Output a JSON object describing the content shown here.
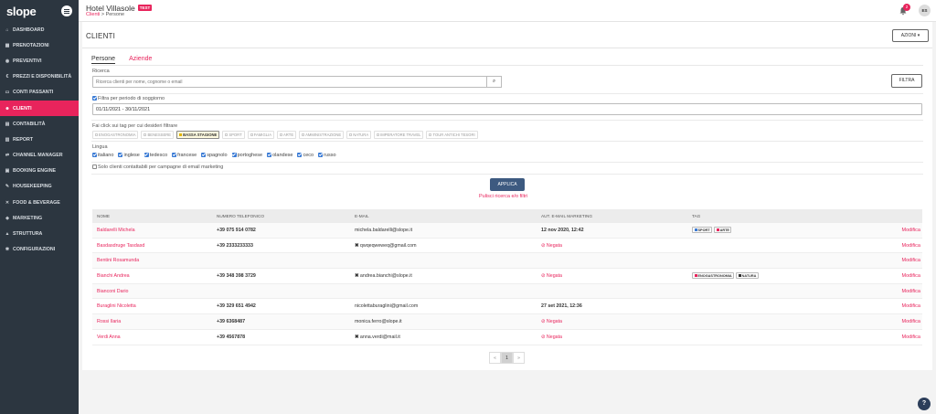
{
  "app": {
    "logo": "slope"
  },
  "sidebar": {
    "items": [
      {
        "icon": "⌂",
        "label": "DASHBOARD"
      },
      {
        "icon": "▦",
        "label": "PRENOTAZIONI"
      },
      {
        "icon": "◉",
        "label": "PREVENTIVI"
      },
      {
        "icon": "€",
        "label": "PREZZI E DISPONIBILITÀ"
      },
      {
        "icon": "▭",
        "label": "CONTI PASSANTI"
      },
      {
        "icon": "☻",
        "label": "CLIENTI",
        "active": true
      },
      {
        "icon": "▤",
        "label": "CONTABILITÀ"
      },
      {
        "icon": "▥",
        "label": "REPORT"
      },
      {
        "icon": "⇄",
        "label": "CHANNEL MANAGER"
      },
      {
        "icon": "▣",
        "label": "BOOKING ENGINE"
      },
      {
        "icon": "✎",
        "label": "HOUSEKEEPING"
      },
      {
        "icon": "✕",
        "label": "FOOD & BEVERAGE"
      },
      {
        "icon": "◈",
        "label": "MARKETING"
      },
      {
        "icon": "▲",
        "label": "STRUTTURA"
      },
      {
        "icon": "✱",
        "label": "CONFIGURAZIONI"
      }
    ]
  },
  "header": {
    "hotel_name": "Hotel Villasole",
    "test_badge": "TEST",
    "breadcrumb_link": "Clienti",
    "breadcrumb_sep": " > ",
    "breadcrumb_current": "Persone",
    "notifications_count": "2",
    "avatar_initials": "ES"
  },
  "page": {
    "title": "CLIENTI",
    "azioni_label": "AZIONI ▾",
    "tabs": [
      {
        "label": "Persone",
        "active": true
      },
      {
        "label": "Aziende",
        "active": false
      }
    ]
  },
  "filters": {
    "search_label": "Ricerca",
    "search_placeholder": "Ricerca clienti per nome, cognome o email",
    "search_icon": "⌕",
    "filtra_label": "FILTRA",
    "period_label": "Filtra per periodo di soggiorno",
    "period_value": "01/11/2021 - 30/11/2021",
    "tags_label": "Fai click sui tag per cui desideri filtrare",
    "tags": [
      {
        "label": "ENOGASTRONOMIA",
        "on": false
      },
      {
        "label": "BENESSERE",
        "on": false
      },
      {
        "label": "BASSA STAGIONE",
        "on": true
      },
      {
        "label": "SPORT",
        "on": false
      },
      {
        "label": "FAMIGLIA",
        "on": false
      },
      {
        "label": "ARTE",
        "on": false
      },
      {
        "label": "AMMINISTRAZIONE",
        "on": false
      },
      {
        "label": "NATURA",
        "on": false
      },
      {
        "label": "IMPERATORE TRAVEL",
        "on": false
      },
      {
        "label": "TOUR ANTICHI TESORI",
        "on": false
      }
    ],
    "lang_label": "Lingua",
    "languages": [
      {
        "label": "italiano",
        "on": true
      },
      {
        "label": "inglese",
        "on": true
      },
      {
        "label": "tedesco",
        "on": true
      },
      {
        "label": "francese",
        "on": true
      },
      {
        "label": "spagnolo",
        "on": true
      },
      {
        "label": "portoghese",
        "on": true
      },
      {
        "label": "olandese",
        "on": true
      },
      {
        "label": "ceco",
        "on": true
      },
      {
        "label": "russo",
        "on": true
      }
    ],
    "marketing_only_label": "Solo clienti contattabili per campagne di email marketing",
    "applica_label": "APPLICA",
    "pulisci_label": "Pulisci ricerca e/o filtri"
  },
  "table": {
    "columns": [
      "NOME",
      "NUMERO TELEFONICO",
      "E-MAIL",
      "AUT. E-MAIL MARKETING",
      "TAG",
      ""
    ],
    "action_label": "Modifica",
    "rows": [
      {
        "name": "Baldarelli Michela",
        "phone": "+39 075 914 0782",
        "email": "michela.baldarelli@slope.it",
        "email_invalid": false,
        "marketing": "12 nov 2020, 12:42",
        "marketing_negated": false,
        "tags": [
          {
            "label": "SPORT",
            "color": "#3a7bd5"
          },
          {
            "label": "ARTE",
            "color": "#e8245c"
          }
        ]
      },
      {
        "name": "Basdasdruge Tasdasd",
        "phone": "+39 2333233333",
        "email": "qwqeqweweq@gmail.com",
        "email_invalid": true,
        "marketing": "Negata",
        "marketing_negated": true,
        "tags": []
      },
      {
        "name": "Bentini Rosamunda",
        "phone": "",
        "email": "",
        "email_invalid": false,
        "marketing": "",
        "marketing_negated": false,
        "tags": []
      },
      {
        "name": "Bianchi Andrea",
        "phone": "+39 348 398 3729",
        "email": "andrea.bianchi@slope.it",
        "email_invalid": true,
        "marketing": "Negata",
        "marketing_negated": true,
        "tags": [
          {
            "label": "ENOGASTRONOMIA",
            "color": "#e8245c"
          },
          {
            "label": "NATURA",
            "color": "#333333"
          }
        ]
      },
      {
        "name": "Bianconi Dario",
        "phone": "",
        "email": "",
        "email_invalid": false,
        "marketing": "",
        "marketing_negated": false,
        "tags": []
      },
      {
        "name": "Buraglini Nicoletta",
        "phone": "+39 329 651 4942",
        "email": "nicolettaburaglini@gmail.com",
        "email_invalid": false,
        "marketing": "27 set 2021, 12:36",
        "marketing_negated": false,
        "tags": []
      },
      {
        "name": "Rossi Ilaria",
        "phone": "+39 6368487",
        "email": "monica.ferro@slope.it",
        "email_invalid": false,
        "marketing": "Negata",
        "marketing_negated": true,
        "tags": []
      },
      {
        "name": "Verdi Anna",
        "phone": "+39 4567878",
        "email": "anna.verdi@mail.it",
        "email_invalid": true,
        "marketing": "Negata",
        "marketing_negated": true,
        "tags": []
      }
    ]
  },
  "pagination": {
    "prev": "«",
    "current": "1",
    "next": "»"
  },
  "help": {
    "label": "?"
  }
}
